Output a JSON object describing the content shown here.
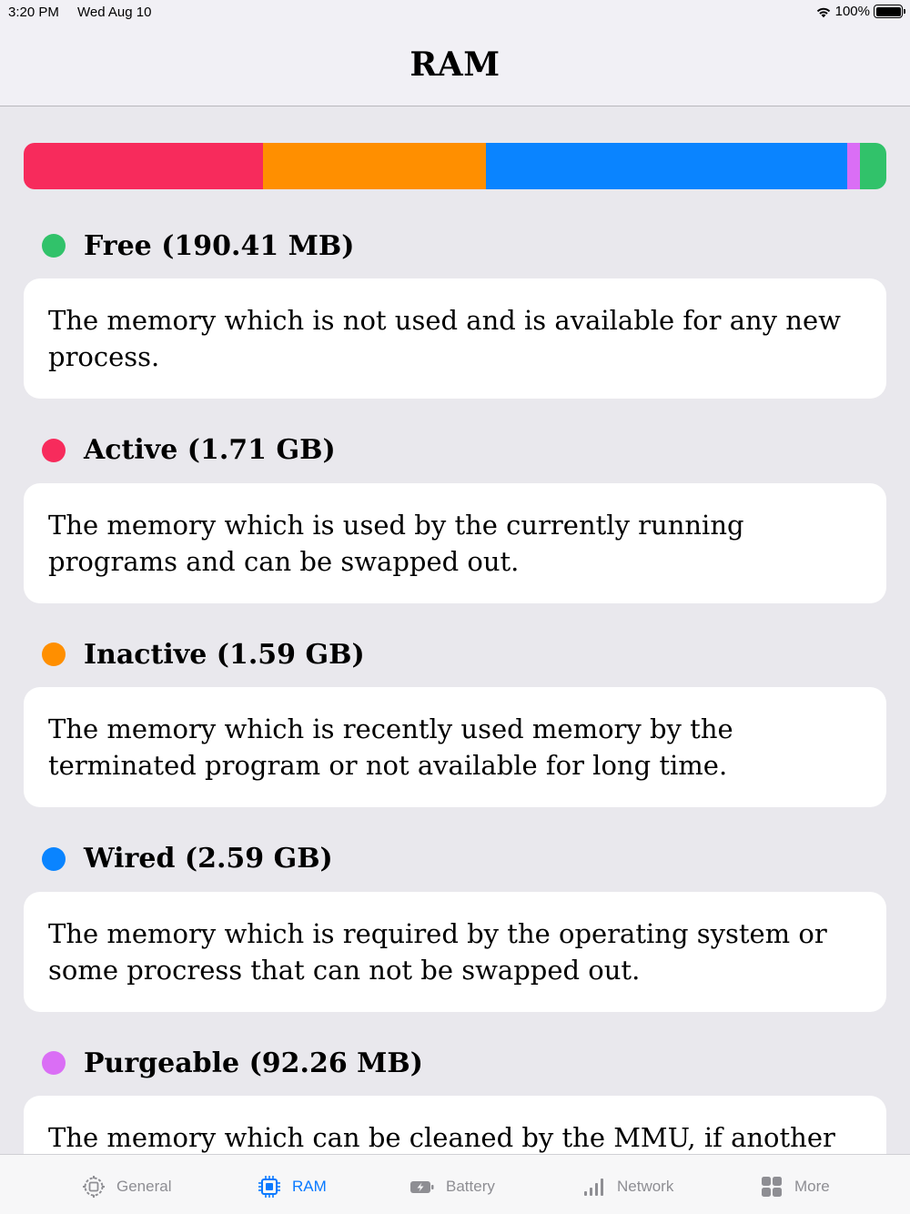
{
  "status": {
    "time": "3:20 PM",
    "date": "Wed Aug 10",
    "battery": "100%",
    "wifi_icon": "wifi-icon",
    "battery_icon": "battery-icon"
  },
  "nav": {
    "title": "RAM"
  },
  "usage_bar": {
    "segments": [
      {
        "name": "active",
        "color": "#f72b5c",
        "fraction": 0.277
      },
      {
        "name": "inactive",
        "color": "#ff8f00",
        "fraction": 0.259
      },
      {
        "name": "wired",
        "color": "#0a84ff",
        "fraction": 0.419
      },
      {
        "name": "purgeable",
        "color": "#da6ef5",
        "fraction": 0.014
      },
      {
        "name": "free",
        "color": "#31c26a",
        "fraction": 0.031
      }
    ]
  },
  "sections": [
    {
      "title": "Free (190.41 MB)",
      "color": "#31c26a",
      "description": "The memory which is not used and is available for any new process."
    },
    {
      "title": "Active (1.71 GB)",
      "color": "#f72b5c",
      "description": "The memory which is used by the currently running programs and can be swapped out."
    },
    {
      "title": "Inactive (1.59 GB)",
      "color": "#ff8f00",
      "description": "The memory which is recently used memory by the terminated program or not available for long time."
    },
    {
      "title": "Wired (2.59 GB)",
      "color": "#0a84ff",
      "description": "The memory which is required by the operating system or some procress that can not be swapped out."
    },
    {
      "title": "Purgeable (92.26 MB)",
      "color": "#da6ef5",
      "description": "The memory which can be cleaned by the MMU, if another"
    }
  ],
  "tabs": [
    {
      "label": "General",
      "icon": "gear-chip-icon",
      "active": false
    },
    {
      "label": "RAM",
      "icon": "chip-icon",
      "active": true
    },
    {
      "label": "Battery",
      "icon": "battery-bolt-icon",
      "active": false
    },
    {
      "label": "Network",
      "icon": "signal-bars-icon",
      "active": false
    },
    {
      "label": "More",
      "icon": "grid-icon",
      "active": false
    }
  ],
  "colors": {
    "accent": "#0a7aff",
    "inactive_tab": "#8e8e93",
    "background": "#e9e8ed"
  }
}
